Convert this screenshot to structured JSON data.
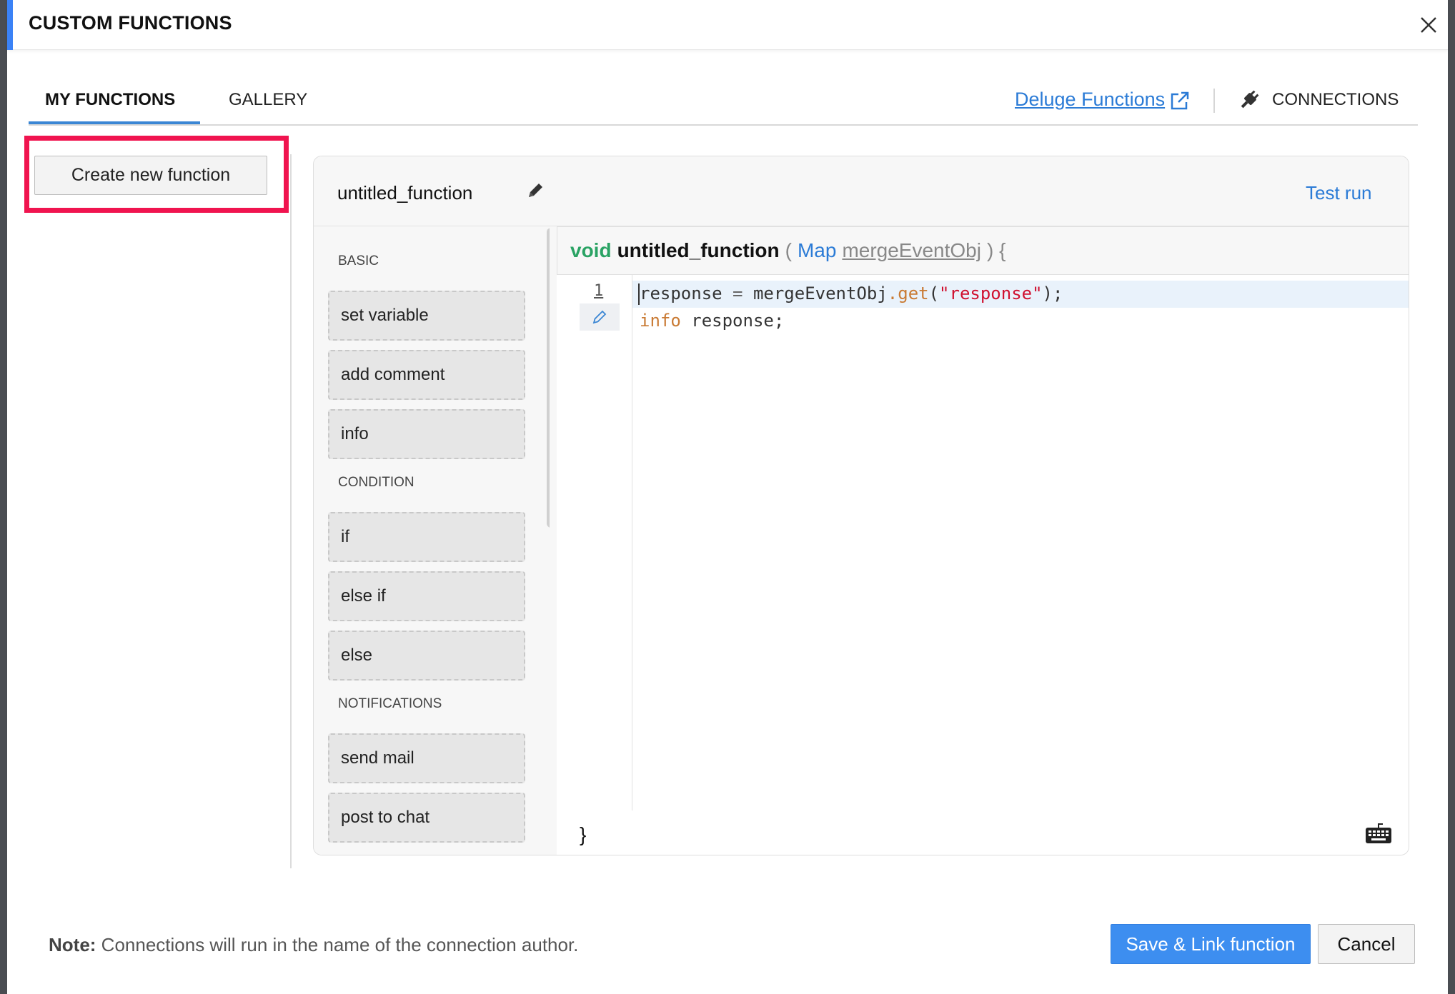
{
  "header": {
    "title": "CUSTOM FUNCTIONS",
    "close_icon": "close-icon"
  },
  "tabs": {
    "items": [
      {
        "label": "MY FUNCTIONS",
        "active": true
      },
      {
        "label": "GALLERY",
        "active": false
      }
    ],
    "deluge_link": "Deluge Functions",
    "connections": "CONNECTIONS"
  },
  "sidebar": {
    "create_button": "Create new function"
  },
  "editor": {
    "function_name": "untitled_function",
    "test_run": "Test run",
    "signature": {
      "return_type": "void",
      "name": "untitled_function",
      "open_paren": "(",
      "param_type": "Map",
      "param_name": "mergeEventObj",
      "close": ") {"
    },
    "line_number": "1",
    "code": {
      "l1_var": "response",
      "l1_eq": " = ",
      "l1_obj": "mergeEventObj",
      "l1_meth": ".get",
      "l1_open": "(",
      "l1_str": "\"response\"",
      "l1_close": ");",
      "l2_kw": "info",
      "l2_rest": " response;"
    },
    "closing_brace": "}"
  },
  "palette": {
    "sections": [
      {
        "heading": "BASIC",
        "items": [
          "set variable",
          "add comment",
          "info"
        ]
      },
      {
        "heading": "CONDITION",
        "items": [
          "if",
          "else if",
          "else"
        ]
      },
      {
        "heading": "NOTIFICATIONS",
        "items": [
          "send mail",
          "post to chat"
        ]
      }
    ]
  },
  "footer": {
    "note_label": "Note:",
    "note_text": " Connections will run in the name of the connection author.",
    "save_button": "Save & Link function",
    "cancel_button": "Cancel"
  },
  "colors": {
    "accent": "#3b82f6",
    "link": "#2b7bd6",
    "highlight": "#f0144f",
    "keyword_green": "#2aa364",
    "string_red": "#d0102f"
  }
}
